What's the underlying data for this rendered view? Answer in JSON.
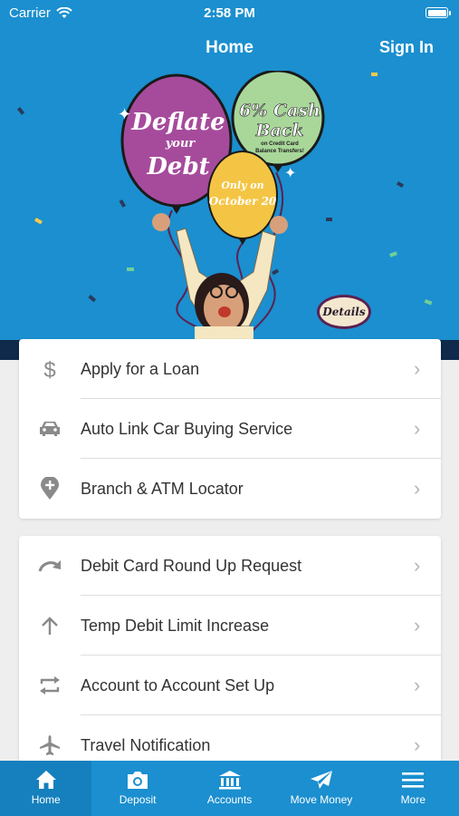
{
  "status_bar": {
    "carrier": "Carrier",
    "time": "2:58 PM"
  },
  "nav": {
    "title": "Home",
    "sign_in": "Sign In"
  },
  "banner": {
    "balloon_purple": [
      "Deflate",
      "your",
      "Debt"
    ],
    "balloon_green": [
      "6% Cash",
      "Back",
      "on Credit Card",
      "Balance Transfers!"
    ],
    "balloon_yellow": [
      "Only on",
      "October 20"
    ],
    "details": "Details"
  },
  "menu_group_1": [
    {
      "label": "Apply for a Loan",
      "icon": "dollar-icon"
    },
    {
      "label": "Auto Link Car Buying Service",
      "icon": "car-icon"
    },
    {
      "label": "Branch & ATM Locator",
      "icon": "location-pin-icon"
    }
  ],
  "menu_group_2": [
    {
      "label": "Debit Card Round Up Request",
      "icon": "redo-arrow-icon"
    },
    {
      "label": "Temp Debit Limit Increase",
      "icon": "arrow-up-icon"
    },
    {
      "label": "Account to Account Set Up",
      "icon": "swap-arrows-icon"
    },
    {
      "label": "Travel Notification",
      "icon": "airplane-icon"
    }
  ],
  "tabbar": [
    {
      "label": "Home",
      "icon": "home-icon",
      "active": true
    },
    {
      "label": "Deposit",
      "icon": "camera-icon",
      "active": false
    },
    {
      "label": "Accounts",
      "icon": "bank-icon",
      "active": false
    },
    {
      "label": "Move Money",
      "icon": "send-icon",
      "active": false
    },
    {
      "label": "More",
      "icon": "menu-icon",
      "active": false
    }
  ],
  "colors": {
    "brand_blue": "#1b8fcf",
    "navy": "#0f2a4a",
    "icon_gray": "#8a8a8a"
  }
}
